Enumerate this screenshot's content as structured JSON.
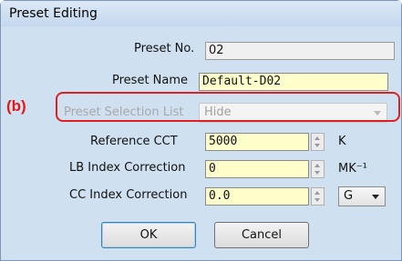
{
  "window": {
    "title": "Preset Editing"
  },
  "form": {
    "preset_no": {
      "label": "Preset No.",
      "value": "02"
    },
    "preset_name": {
      "label": "Preset Name",
      "value": "Default-D02"
    },
    "preset_selection_list": {
      "label": "Preset Selection List",
      "value": "Hide"
    },
    "reference_cct": {
      "label": "Reference CCT",
      "value": "5000",
      "unit": "K"
    },
    "lb_index_correction": {
      "label": "LB Index Correction",
      "value": "0",
      "unit": "MK⁻¹"
    },
    "cc_index_correction": {
      "label": "CC Index Correction",
      "value": "0.0",
      "unit_select": "G"
    }
  },
  "buttons": {
    "ok": "OK",
    "cancel": "Cancel"
  },
  "annotation": {
    "label": "(b)",
    "color": "#e02020"
  },
  "icons": [
    "spinner-icon",
    "chevron-down-icon"
  ]
}
